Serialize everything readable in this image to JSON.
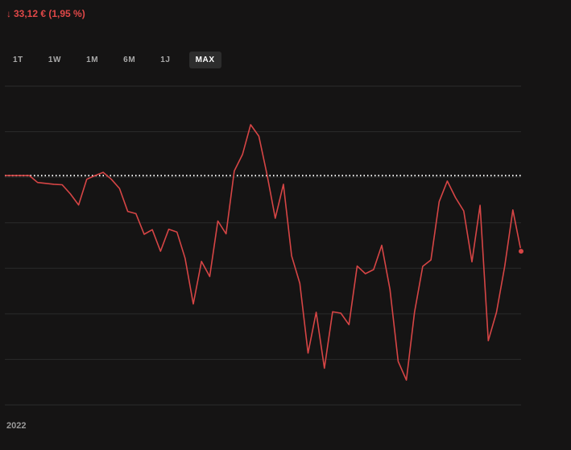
{
  "header": {
    "change_arrow": "↓",
    "change_text": "33,12 €  (1,95 %)"
  },
  "ranges": [
    "1T",
    "1W",
    "1M",
    "6M",
    "1J",
    "MAX"
  ],
  "active_range": "MAX",
  "chart_data": {
    "type": "line",
    "xlabel": "",
    "ylabel": "",
    "x_tick_labels": [
      "2022"
    ],
    "y_relative_to_baseline": true,
    "reference_line": {
      "value": 0,
      "style": "dotted"
    },
    "ylim": [
      -5.0,
      1.95
    ],
    "grid": "horizontal",
    "line_color": "#d64545",
    "series": [
      {
        "values": [
          0,
          0,
          0,
          0,
          -0.15,
          -0.17,
          -0.19,
          -0.2,
          -0.4,
          -0.64,
          -0.08,
          0,
          0.07,
          -0.08,
          -0.28,
          -0.78,
          -0.83,
          -1.28,
          -1.18,
          -1.65,
          -1.17,
          -1.23,
          -1.8,
          -2.8,
          -1.87,
          -2.2,
          -0.99,
          -1.27,
          0.1,
          0.46,
          1.11,
          0.86,
          0.02,
          -0.93,
          -0.19,
          -1.75,
          -2.35,
          -3.87,
          -2.98,
          -4.2,
          -2.97,
          -3.0,
          -3.25,
          -1.97,
          -2.14,
          -2.05,
          -1.52,
          -2.48,
          -4.05,
          -4.46,
          -2.98,
          -1.98,
          -1.84,
          -0.57,
          -0.12,
          -0.48,
          -0.77,
          -1.88,
          -0.65,
          -3.6,
          -2.98,
          -1.98,
          -0.75,
          -1.65
        ],
        "last_point_marker": true
      }
    ]
  }
}
